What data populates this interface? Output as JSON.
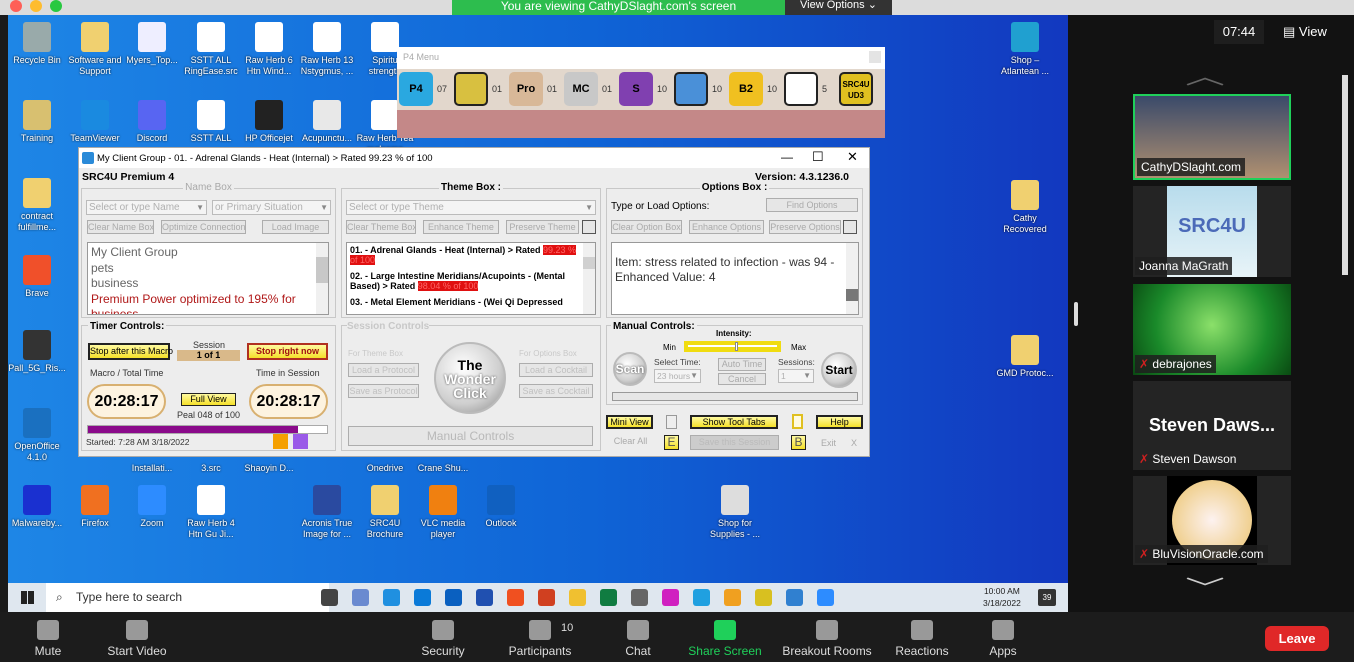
{
  "zoom_top": {
    "banner": "You are viewing CathyDSlaght.com's screen",
    "view_options": "View Options ⌄"
  },
  "desktop_icons": [
    "Recycle Bin",
    "Software and Support",
    "Myers_Top...",
    "SSTT ALL RingEase.src",
    "Raw Herb 6 Htn Wind...",
    "Raw Herb 13 Nstygmus, ...",
    "Spiritu strength",
    "Training",
    "TeamViewer",
    "Discord",
    "SSTT ALL",
    "HP Officejet",
    "Acupunctu...",
    "Raw Herb Tea malcome",
    "contract fulfillme...",
    "Brave",
    "Pall_5G_Ris...",
    "OpenOffice 4.1.0",
    "Installati...",
    "3.src",
    "Shaoyin D...",
    "Onedrive",
    "Crane Shu...",
    "Malwareby...",
    "Firefox",
    "Zoom",
    "Raw Herb 4 Htn Gu Ji...",
    "Acronis True Image for ...",
    "SRC4U Brochure",
    "VLC media player",
    "Outlook",
    "Shop for Supplies - ...",
    "Shop – Atlantean ...",
    "Cathy Recovered",
    "GMD Protoc..."
  ],
  "p4menu": {
    "title": "P4 Menu",
    "items": [
      {
        "label": "P4",
        "count": "07",
        "color": "#2aa8e0"
      },
      {
        "label": "clock",
        "count": "01",
        "color": "#d8c040"
      },
      {
        "label": "Pro",
        "count": "01",
        "color": "#d8b898"
      },
      {
        "label": "MC",
        "count": "01",
        "color": "#c8c8c8"
      },
      {
        "label": "S",
        "count": "10",
        "color": "#8040b0"
      },
      {
        "label": "runner",
        "count": "10",
        "color": "#4a90d8"
      },
      {
        "label": "B2",
        "count": "10",
        "color": "#f0c020"
      },
      {
        "label": "spiral",
        "count": "5",
        "color": "#fff"
      },
      {
        "label": "SRC4U UD3",
        "count": "",
        "color": "#e0c020"
      }
    ]
  },
  "app": {
    "title": "My Client Group - 01. - Adrenal Glands - Heat (Internal) > Rated  99.23 % of 100",
    "product": "SRC4U Premium 4",
    "version": "Version: 4.3.1236.0",
    "name_box": {
      "legend": "Name Box",
      "name_placeholder": "Select or type Name",
      "situation_placeholder": "or Primary Situation",
      "clear": "Clear Name Box",
      "optimize": "Optimize Connection",
      "load_image": "Load Image",
      "items": [
        "My Client Group",
        "pets",
        "business",
        "Premium Power optimized to 195% for business"
      ]
    },
    "theme_box": {
      "legend": "Theme Box :",
      "placeholder": "Select or type Theme",
      "clear": "Clear Theme Box",
      "enhance": "Enhance Theme",
      "preserve": "Preserve Theme",
      "items": [
        {
          "text": "01. - Adrenal Glands - Heat (Internal) > Rated",
          "rating": "99.23 % of 100"
        },
        {
          "text": "02. - Large Intestine Meridians/Acupoints - (Mental Based) > Rated",
          "rating": "98.04 % of 100"
        },
        {
          "text": "03. - Metal Element Meridians - (Wei Qi Depressed",
          "rating": ""
        }
      ]
    },
    "options_box": {
      "legend": "Options Box :",
      "type_label": "Type or Load Options:",
      "find": "Find Options",
      "clear": "Clear Option Box",
      "enhance": "Enhance Options",
      "preserve": "Preserve Options",
      "text": "Item: stress related to infection - was 94 - Enhanced Value: 4"
    },
    "timer": {
      "legend": "Timer Controls:",
      "stop_macro": "Stop after this Macro",
      "session_label": "Session",
      "session_value": "1 of 1",
      "stop_now": "Stop right now",
      "macro_label": "Macro / Total Time",
      "session_time_label": "Time in Session",
      "macro_time": "20:28:17",
      "session_time": "20:28:17",
      "full_view": "Full View",
      "peal": "Peal  048 of 100",
      "progress": 0.88,
      "started": "Started: 7:28 AM 3/18/2022",
      "colors": [
        "#f5a000",
        "#9a5ae8"
      ]
    },
    "session_controls": {
      "legend": "Session Controls",
      "for_theme": "For Theme Box",
      "load_protocol": "Load a Protocol",
      "save_protocol": "Save as Protocol",
      "wonder": [
        "The",
        "Wonder",
        "Click"
      ],
      "for_options": "For Options Box",
      "load_cocktail": "Load a Cocktail",
      "save_cocktail": "Save as Cocktail",
      "manual": "Manual Controls"
    },
    "manual": {
      "legend": "Manual Controls:",
      "intensity": "Intensity:",
      "min": "Min",
      "max": "Max",
      "intensity_value": 0.55,
      "scan": "Scan",
      "select_time": "Select Time:",
      "time_value": "23 hours",
      "auto_time": "Auto Time",
      "cancel": "Cancel",
      "sessions_label": "Sessions:",
      "sessions_value": "1",
      "start": "Start"
    },
    "bottom": {
      "mini_view": "Mini View",
      "show_tool_tabs": "Show Tool Tabs",
      "help": "Help",
      "clear_all": "Clear All",
      "e": "E",
      "save_session": "Save this Session",
      "b": "B",
      "exit": "Exit",
      "x": "X"
    }
  },
  "taskbar": {
    "search_placeholder": "Type here to search",
    "time": "10:00 AM",
    "date": "3/18/2022",
    "notifications": "39"
  },
  "zoom": {
    "timer": "07:44",
    "view": "View",
    "participants": [
      "CathyDSlaght.com",
      "Joanna MaGrath",
      "debrajones",
      "Steven Dawson",
      "BluVisionOracle.com"
    ],
    "big_name": "Steven Daws...",
    "toolbar": [
      {
        "label": "Mute"
      },
      {
        "label": "Start Video"
      },
      {
        "label": "Security"
      },
      {
        "label": "Participants",
        "count": "10"
      },
      {
        "label": "Chat"
      },
      {
        "label": "Share Screen"
      },
      {
        "label": "Breakout Rooms"
      },
      {
        "label": "Reactions"
      },
      {
        "label": "Apps"
      }
    ],
    "leave": "Leave",
    "accent": "#1fd05a",
    "leave_color": "#e02828"
  }
}
